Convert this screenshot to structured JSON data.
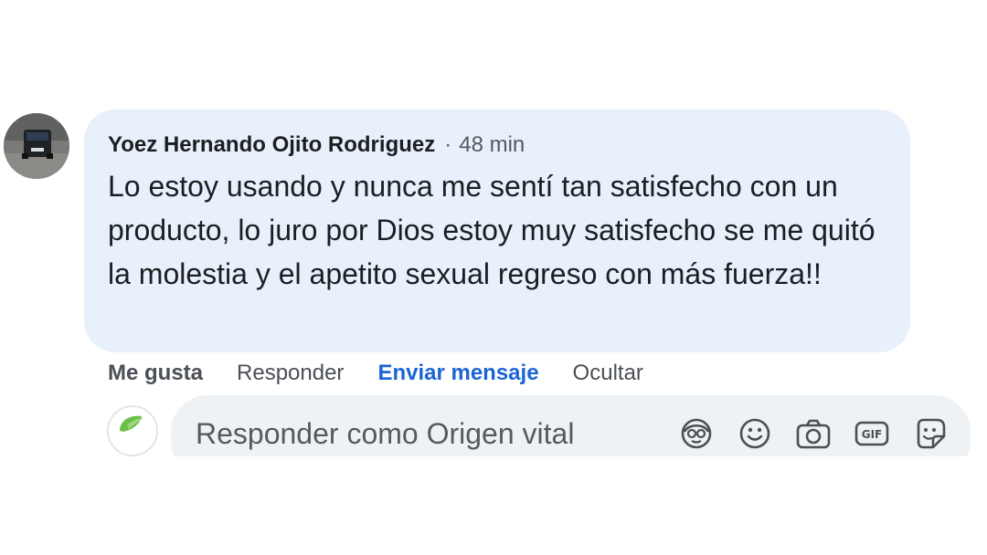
{
  "comment": {
    "author": "Yoez Hernando Ojito Rodriguez",
    "separator": "·",
    "time": "48 min",
    "text": "Lo estoy usando y nunca me sentí tan satisfecho con un producto, lo juro por Dios estoy muy satisfecho se me quitó la molestia y el apetito sexual regreso con más fuerza!!"
  },
  "actions": {
    "like": "Me gusta",
    "reply": "Responder",
    "send_message": "Enviar mensaje",
    "hide": "Ocultar"
  },
  "reply_box": {
    "placeholder": "Responder como Origen vital",
    "icons": [
      "avatar-sticker-icon",
      "emoji-icon",
      "camera-icon",
      "gif-icon",
      "sticker-icon"
    ],
    "gif_text": "GIF"
  },
  "colors": {
    "bubble_bg": "#e7f0fb",
    "link_blue": "#1b64d6",
    "reply_bg": "#eff2f5",
    "brand_green": "#4caf2a"
  }
}
